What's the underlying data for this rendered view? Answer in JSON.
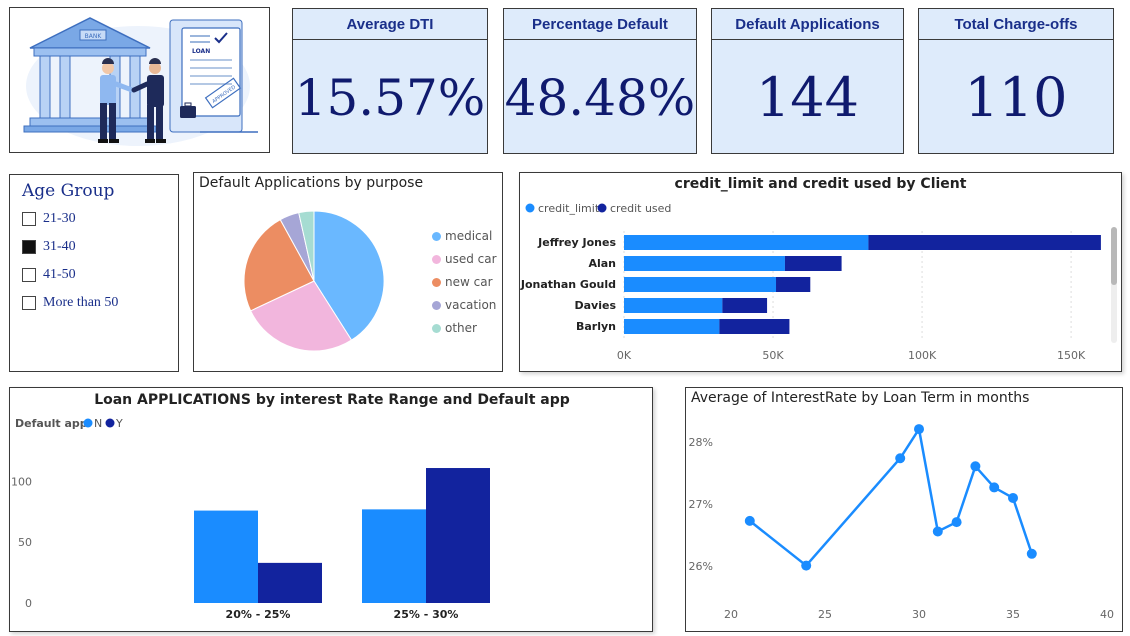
{
  "kpis": [
    {
      "title": "Average DTI",
      "value": "15.57%"
    },
    {
      "title": "Percentage Default",
      "value": "48.48%"
    },
    {
      "title": "Default Applications",
      "value": "144"
    },
    {
      "title": "Total Charge-offs",
      "value": "110"
    }
  ],
  "logo": {
    "bank_sign": "BANK",
    "document_label": "LOAN",
    "stamp_label": "APPROVED"
  },
  "slicer": {
    "title": "Age Group",
    "items": [
      {
        "label": "21-30",
        "checked": false
      },
      {
        "label": "31-40",
        "checked": true
      },
      {
        "label": "41-50",
        "checked": false
      },
      {
        "label": "More than 50",
        "checked": false
      }
    ]
  },
  "pie_title": "Default Applications by purpose",
  "credit_title": "credit_limit and credit used by Client",
  "loan_title": "Loan APPLICATIONS by interest Rate Range and Default app",
  "loan_legend_title": "Default app",
  "interest_title": "Average of InterestRate by Loan Term in months",
  "colors": {
    "kpi_bg": "#deebfb",
    "kpi_text": "#0f1a6e",
    "primary_blue": "#1a8cff",
    "dark_blue": "#12239e",
    "pie_medical": "#6ab8ff",
    "pie_used_car": "#f2b6dd",
    "pie_new_car": "#ec8d62",
    "pie_vacation": "#a6a6d6",
    "pie_other": "#a6dcd2"
  },
  "chart_data": [
    {
      "type": "pie",
      "title": "Default Applications by purpose",
      "categories": [
        "medical",
        "used car",
        "new car",
        "vacation",
        "other"
      ],
      "values": [
        41,
        27,
        24,
        4.5,
        3.5
      ],
      "colors": [
        "#6ab8ff",
        "#f2b6dd",
        "#ec8d62",
        "#a6a6d6",
        "#a6dcd2"
      ],
      "legend": "right"
    },
    {
      "type": "bar",
      "orientation": "horizontal",
      "stacked": true,
      "title": "credit_limit and credit used by Client",
      "categories": [
        "Jeffrey Jones",
        "Alan",
        "Jonathan Gould",
        "Davies",
        "Barlyn"
      ],
      "series": [
        {
          "name": "credit_limit",
          "values": [
            82000,
            54000,
            51000,
            33000,
            32000
          ],
          "color": "#1a8cff"
        },
        {
          "name": "credit used",
          "values": [
            78000,
            19000,
            11500,
            15000,
            23500
          ],
          "color": "#12239e"
        }
      ],
      "xticks": [
        "0K",
        "50K",
        "100K",
        "150K"
      ],
      "xlim": [
        0,
        165000
      ],
      "legend": "top-left"
    },
    {
      "type": "bar",
      "title": "Loan APPLICATIONS by interest Rate Range and Default app",
      "categories": [
        "20% - 25%",
        "25% - 30%"
      ],
      "series": [
        {
          "name": "N",
          "values": [
            76,
            77
          ],
          "color": "#1a8cff"
        },
        {
          "name": "Y",
          "values": [
            33,
            111
          ],
          "color": "#12239e"
        }
      ],
      "yticks": [
        0,
        50,
        100
      ],
      "ylim": [
        0,
        125
      ],
      "legend": "top-left"
    },
    {
      "type": "line",
      "title": "Average of InterestRate by Loan Term in months",
      "x": [
        21,
        24,
        29,
        30,
        31,
        32,
        33,
        34,
        35,
        36
      ],
      "y": [
        26.73,
        26.01,
        27.74,
        28.21,
        26.56,
        26.71,
        27.61,
        27.27,
        27.1,
        26.2
      ],
      "xticks": [
        20,
        25,
        30,
        35,
        40
      ],
      "yticks": [
        "26%",
        "27%",
        "28%"
      ],
      "xlim": [
        20,
        40
      ],
      "ylim": [
        25.6,
        28.55
      ],
      "color": "#1a8cff"
    }
  ]
}
